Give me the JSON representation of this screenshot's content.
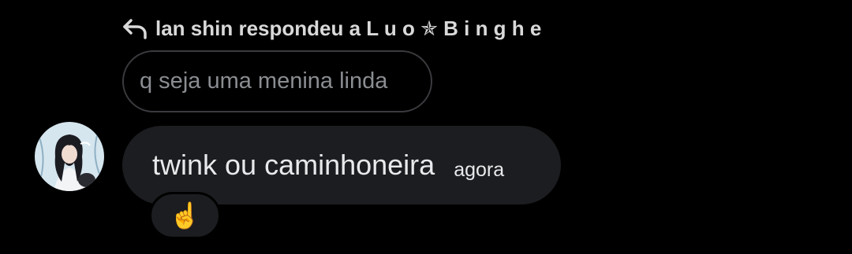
{
  "reply_header": {
    "icon": "reply-arrow-icon",
    "text": "lan shin respondeu a L u o ✯ B i n g h e"
  },
  "quoted_message": {
    "text": "q seja uma menina linda"
  },
  "message": {
    "avatar_icon": "user-avatar",
    "text": "twink ou caminhoneira",
    "time": "agora"
  },
  "reaction": {
    "emoji": "☝️"
  },
  "colors": {
    "background": "#000000",
    "bubble": "#1c1d20",
    "quoted_border": "#3a3b3f",
    "quoted_text": "#8a8d91",
    "text": "#e7e9ea"
  }
}
